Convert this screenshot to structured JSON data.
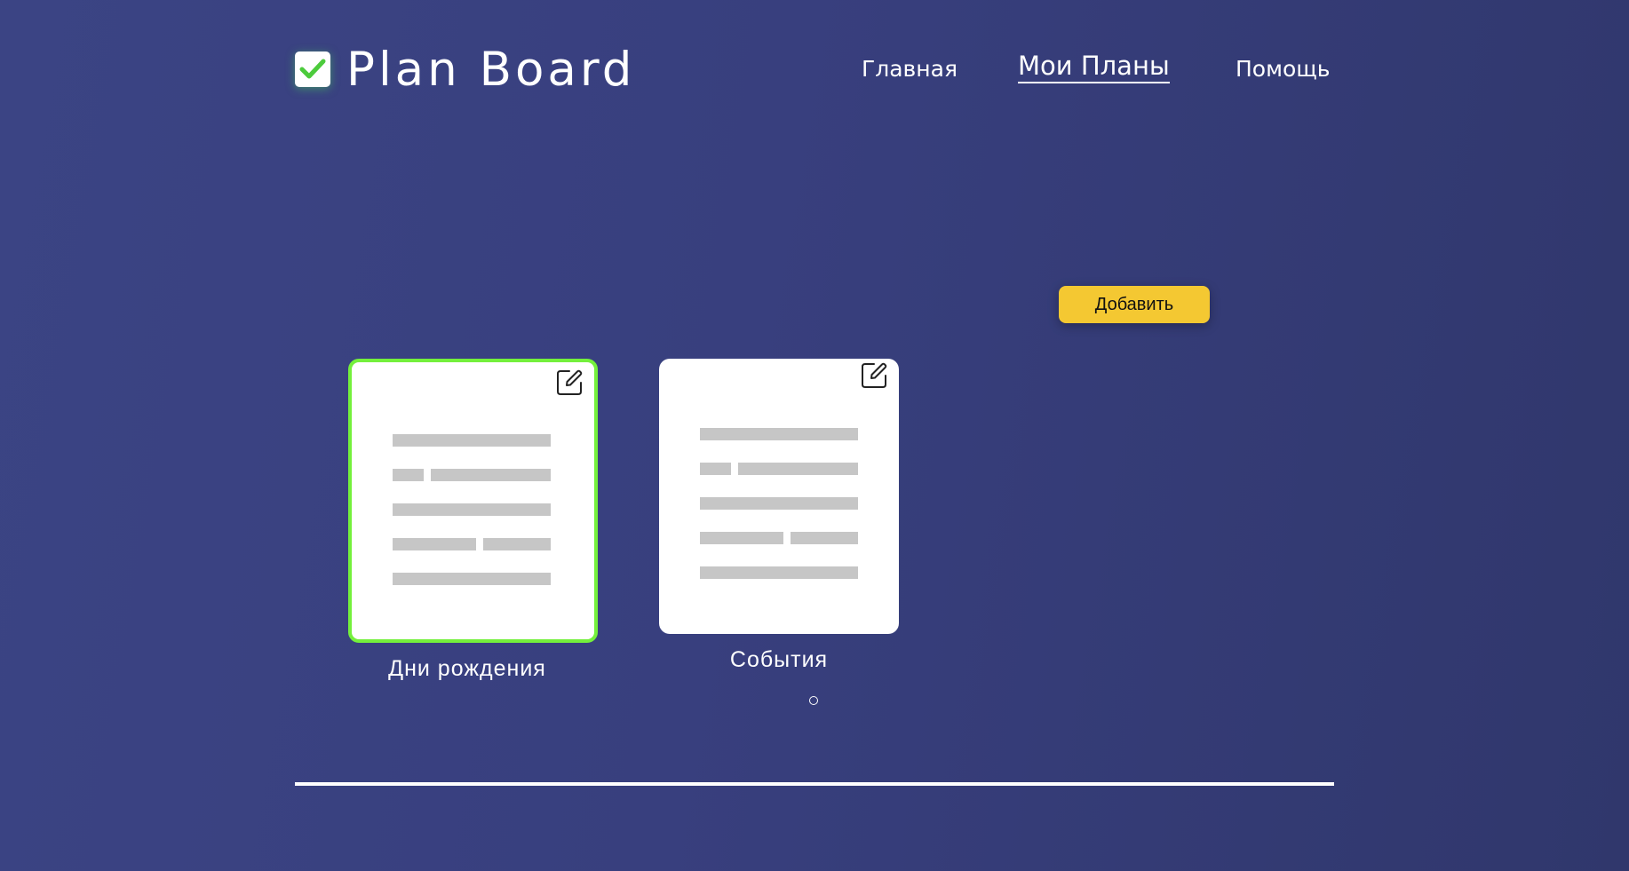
{
  "brand": {
    "title": "Plan Board",
    "icon": "checkbox-check-icon",
    "check_color": "#4ccb3c"
  },
  "nav": {
    "items": [
      {
        "label": "Главная",
        "active": false
      },
      {
        "label": "Мои Планы",
        "active": true
      },
      {
        "label": "Помощь",
        "active": false
      }
    ]
  },
  "toolbar": {
    "add_label": "Добавить"
  },
  "plans": [
    {
      "label": "Дни рождения",
      "selected": true,
      "icon": "edit-icon"
    },
    {
      "label": "События",
      "selected": false,
      "icon": "edit-icon"
    }
  ],
  "pagination": {
    "dot_icon": "page-dot"
  },
  "colors": {
    "background": "#383f7e",
    "accent_yellow": "#f4c832",
    "selected_border": "#74f03c",
    "placeholder_bar": "#c6c6c6"
  }
}
